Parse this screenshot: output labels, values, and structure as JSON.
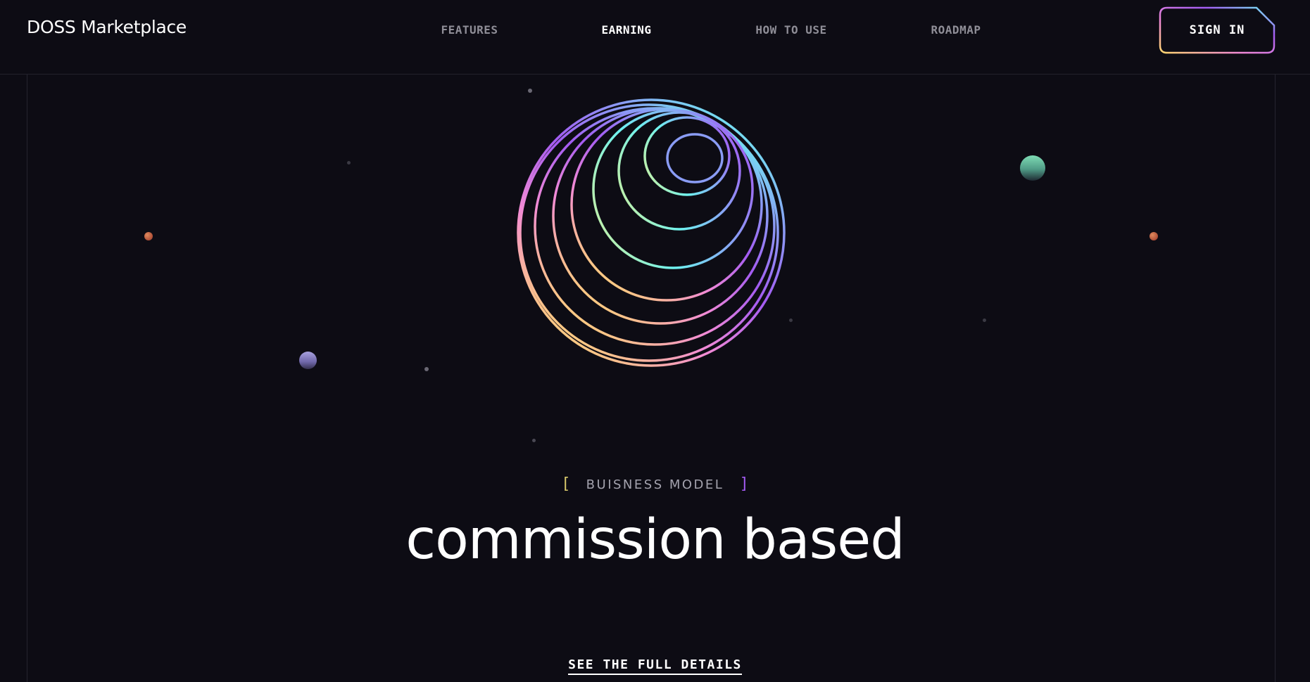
{
  "brand": {
    "name": "DOSS Marketplace"
  },
  "nav": {
    "items": [
      {
        "label": "FEATURES",
        "active": false
      },
      {
        "label": "EARNING",
        "active": true
      },
      {
        "label": "HOW TO USE",
        "active": false
      },
      {
        "label": "ROADMAP",
        "active": false
      }
    ]
  },
  "header": {
    "signin_label": "SIGN IN"
  },
  "hero": {
    "kicker": "BUISNESS MODEL",
    "bracket_open": "[",
    "bracket_close": "]",
    "title": "commission based",
    "cta_label": "SEE THE FULL DETAILS"
  },
  "colors": {
    "background": "#0d0c14",
    "gradient_cyan": "#6ef3f0",
    "gradient_violet": "#a35bf2",
    "gradient_pink": "#f28ad6",
    "gradient_yellow": "#ffd86e",
    "planet_green": "#6fcfa8",
    "planet_lavender": "#9b94d6",
    "planet_red": "#c4533c"
  }
}
